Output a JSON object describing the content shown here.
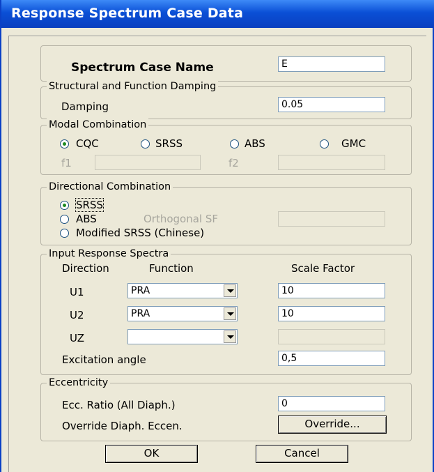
{
  "window": {
    "title": "Response Spectrum Case Data"
  },
  "case_name": {
    "label": "Spectrum Case Name",
    "value": "E"
  },
  "damping": {
    "legend": "Structural and Function Damping",
    "label": "Damping",
    "value": "0.05"
  },
  "modal": {
    "legend": "Modal Combination",
    "options": [
      "CQC",
      "SRSS",
      "ABS",
      "GMC"
    ],
    "selected": "CQC",
    "f1_label": "f1",
    "f1_value": "",
    "f2_label": "f2",
    "f2_value": ""
  },
  "directional": {
    "legend": "Directional Combination",
    "opt_srss": "SRSS",
    "opt_abs": "ABS",
    "opt_modified": "Modified SRSS (Chinese)",
    "selected": "SRSS",
    "orth_label": "Orthogonal SF",
    "orth_value": ""
  },
  "spectra": {
    "legend": "Input Response Spectra",
    "col_direction": "Direction",
    "col_function": "Function",
    "col_scale": "Scale Factor",
    "rows": [
      {
        "dir": "U1",
        "func": "PRA",
        "scale": "10"
      },
      {
        "dir": "U2",
        "func": "PRA",
        "scale": "10"
      },
      {
        "dir": "UZ",
        "func": "",
        "scale": ""
      }
    ],
    "excitation_label": "Excitation  angle",
    "excitation_value": "0,5"
  },
  "eccentricity": {
    "legend": "Eccentricity",
    "ratio_label": "Ecc. Ratio (All Diaph.)",
    "ratio_value": "0",
    "override_label": "Override Diaph. Eccen.",
    "override_button": "Override..."
  },
  "buttons": {
    "ok": "OK",
    "cancel": "Cancel"
  },
  "colors": {
    "title_bar": "#0a4fd6",
    "dialog_bg": "#ece9d8",
    "radio_selected": "#1f8a1f"
  }
}
